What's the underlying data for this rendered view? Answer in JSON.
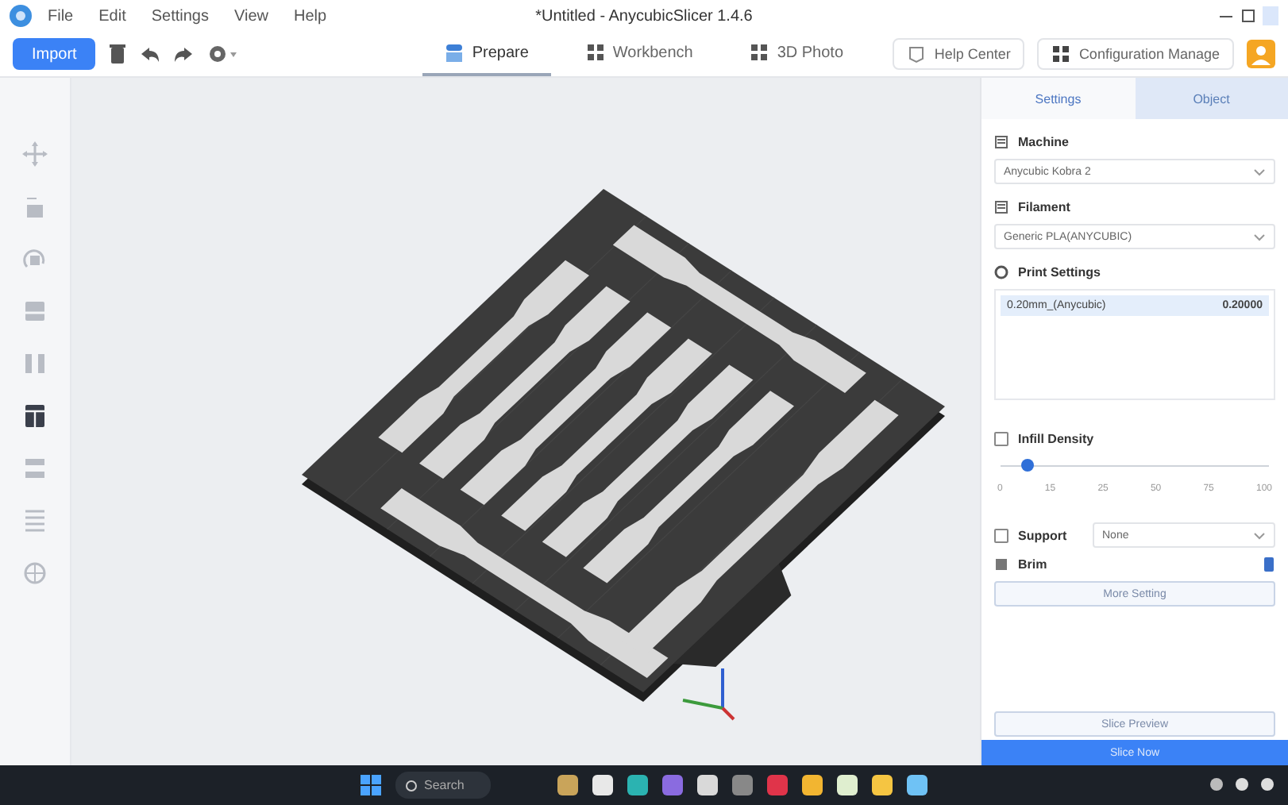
{
  "window": {
    "title": "*Untitled - AnycubicSlicer 1.4.6"
  },
  "menu": [
    "File",
    "Edit",
    "Settings",
    "View",
    "Help"
  ],
  "toolbar": {
    "import_label": "Import"
  },
  "mode_tabs": [
    {
      "label": "Prepare",
      "selected": true
    },
    {
      "label": "Workbench",
      "selected": false
    },
    {
      "label": "3D Photo",
      "selected": false
    }
  ],
  "header_buttons": [
    "Help Center",
    "Configuration Manage"
  ],
  "side_tools": [
    {
      "kind": "move",
      "selected": false
    },
    {
      "kind": "scale",
      "selected": false
    },
    {
      "kind": "rotate",
      "selected": false
    },
    {
      "kind": "cut",
      "selected": false
    },
    {
      "kind": "mirror",
      "selected": false
    },
    {
      "kind": "slice",
      "selected": true
    },
    {
      "kind": "layers",
      "selected": false
    },
    {
      "kind": "stack",
      "selected": false
    },
    {
      "kind": "paint",
      "selected": false
    }
  ],
  "panel_tabs": [
    {
      "label": "Settings",
      "selected": true
    },
    {
      "label": "Object",
      "selected": false
    }
  ],
  "machine": {
    "label": "Machine",
    "value": "Anycubic Kobra 2"
  },
  "filament": {
    "label": "Filament",
    "value": "Generic PLA(ANYCUBIC)"
  },
  "print_settings": {
    "label": "Print Settings",
    "preset": "0.20mm_(Anycubic)",
    "value": "0.20000"
  },
  "infill": {
    "label": "Infill Density",
    "checked": false,
    "level": 0.1,
    "ticks": [
      "0",
      "15",
      "25",
      "50",
      "75",
      "100"
    ]
  },
  "support": {
    "label": "Support",
    "checked": false,
    "value": "None"
  },
  "brim": {
    "label": "Brim"
  },
  "more_button": "More Setting",
  "preview_button": "Slice Preview",
  "slice_button": "Slice Now",
  "taskbar": {
    "search": "Search"
  }
}
